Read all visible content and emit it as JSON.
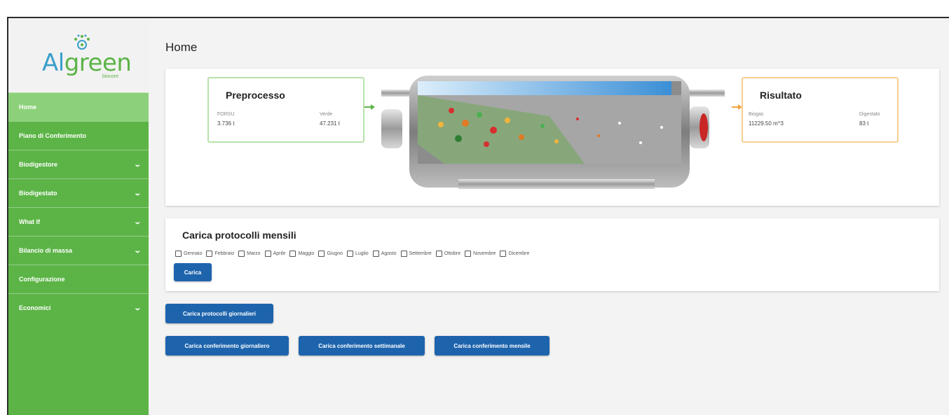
{
  "logo": {
    "text_a": "Al",
    "text_b": "green",
    "subtitle": "biocore"
  },
  "sidebar": {
    "items": [
      {
        "label": "Home",
        "active": true,
        "has_children": false
      },
      {
        "label": "Piano di Conferimento",
        "active": false,
        "has_children": false
      },
      {
        "label": "Biodigestore",
        "active": false,
        "has_children": true
      },
      {
        "label": "Biodigestato",
        "active": false,
        "has_children": true
      },
      {
        "label": "What If",
        "active": false,
        "has_children": true
      },
      {
        "label": "Bilancio di massa",
        "active": false,
        "has_children": true
      },
      {
        "label": "Configurazione",
        "active": false,
        "has_children": false
      },
      {
        "label": "Economici",
        "active": false,
        "has_children": true
      }
    ]
  },
  "header": {
    "title": "Home"
  },
  "process": {
    "preprocess": {
      "title": "Preprocesso",
      "left_label": "FORSU",
      "left_value": "3.736 t",
      "right_label": "Verde",
      "right_value": "47.231 t"
    },
    "result": {
      "title": "Risultato",
      "left_label": "Biogas",
      "left_value": "11229.50 m^3",
      "right_label": "Digestato",
      "right_value": "83 t"
    }
  },
  "monthly": {
    "title": "Carica protocolli mensili",
    "months": [
      "Gennaio",
      "Febbraio",
      "Marzo",
      "Aprile",
      "Maggio",
      "Giugno",
      "Luglio",
      "Agosto",
      "Settembre",
      "Ottobre",
      "Novembre",
      "Dicembre"
    ],
    "load_button": "Carica"
  },
  "actions": {
    "daily_protocols": "Carica protocolli giornalieri",
    "daily_delivery": "Carica conferimento giornaliero",
    "weekly_delivery": "Carica conferimento settimanale",
    "monthly_delivery": "Carica conferimento mensile"
  },
  "colors": {
    "sidebar": "#5cb447",
    "sidebar_active": "#8cd17a",
    "button": "#1d64ad",
    "preprocess_border": "#b6e2a9",
    "result_border": "#f5cf8e",
    "arrow_green": "#5cb447",
    "arrow_orange": "#f0a23a"
  }
}
